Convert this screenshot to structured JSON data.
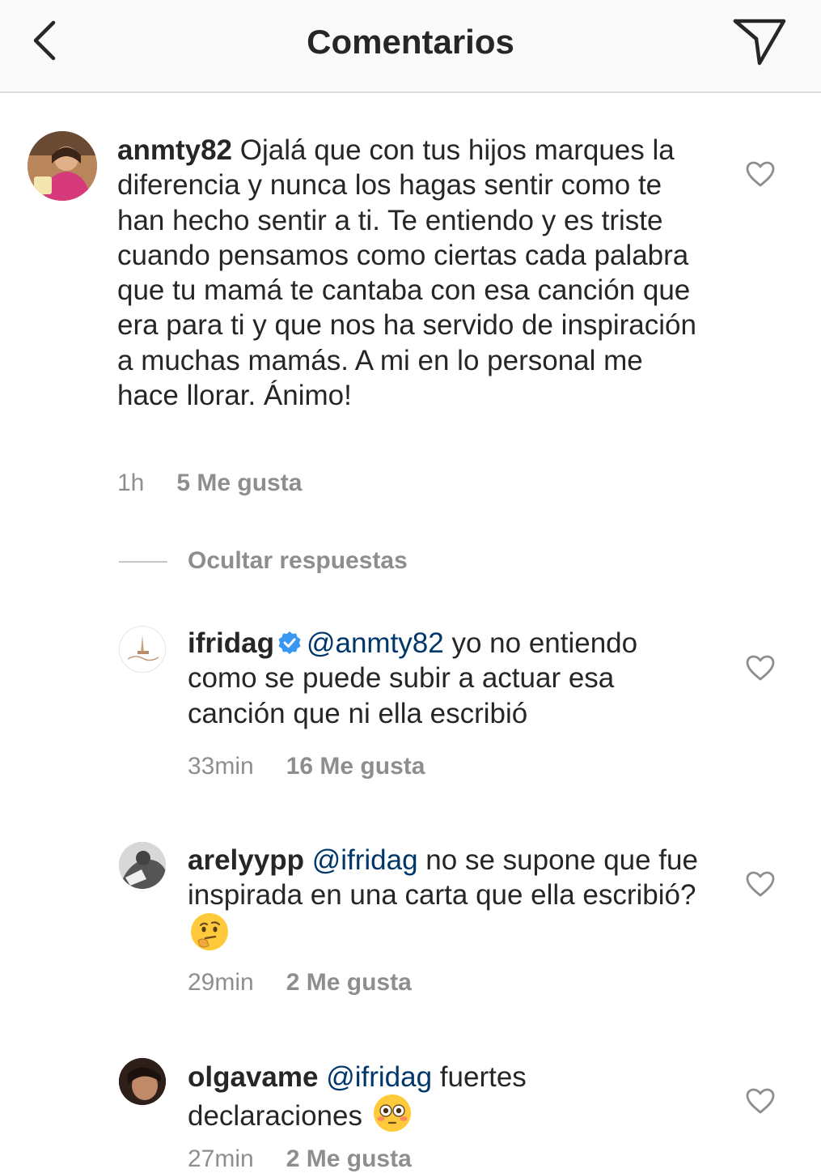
{
  "header": {
    "title": "Comentarios",
    "back_icon": "chevron-left-icon",
    "send_icon": "paper-plane-icon"
  },
  "comments": [
    {
      "username": "anmty82",
      "text": "Ojalá que con tus hijos marques la diferencia y nunca los hagas sentir como te han hecho sentir a ti. Te entiendo y es triste cuando pensamos como ciertas cada palabra que tu mamá te cantaba con esa canción que era para ti y que nos ha servido de inspiración a muchas mamás. A mi en lo personal me hace llorar. Ánimo!",
      "time": "1h",
      "likes": "5 Me gusta"
    }
  ],
  "hide_replies_label": "Ocultar respuestas",
  "replies": [
    {
      "username": "ifridag",
      "verified": true,
      "mention": "@anmty82",
      "text": "yo no entiendo como se puede subir a actuar esa canción que ni ella escribió",
      "time": "33min",
      "likes": "16 Me gusta"
    },
    {
      "username": "arelyypp",
      "mention": "@ifridag",
      "text": "no se supone que fue inspirada en una carta que ella escribió?",
      "emoji": "thinking-face-emoji",
      "time": "29min",
      "likes": "2 Me gusta"
    },
    {
      "username": "olgavame",
      "mention": "@ifridag",
      "text": "fuertes declaraciones",
      "emoji": "flushed-face-emoji",
      "time": "27min",
      "likes": "2 Me gusta"
    }
  ],
  "colors": {
    "text": "#262626",
    "secondary": "#8e8e8e",
    "mention": "#00376b",
    "verified": "#3897f0"
  }
}
